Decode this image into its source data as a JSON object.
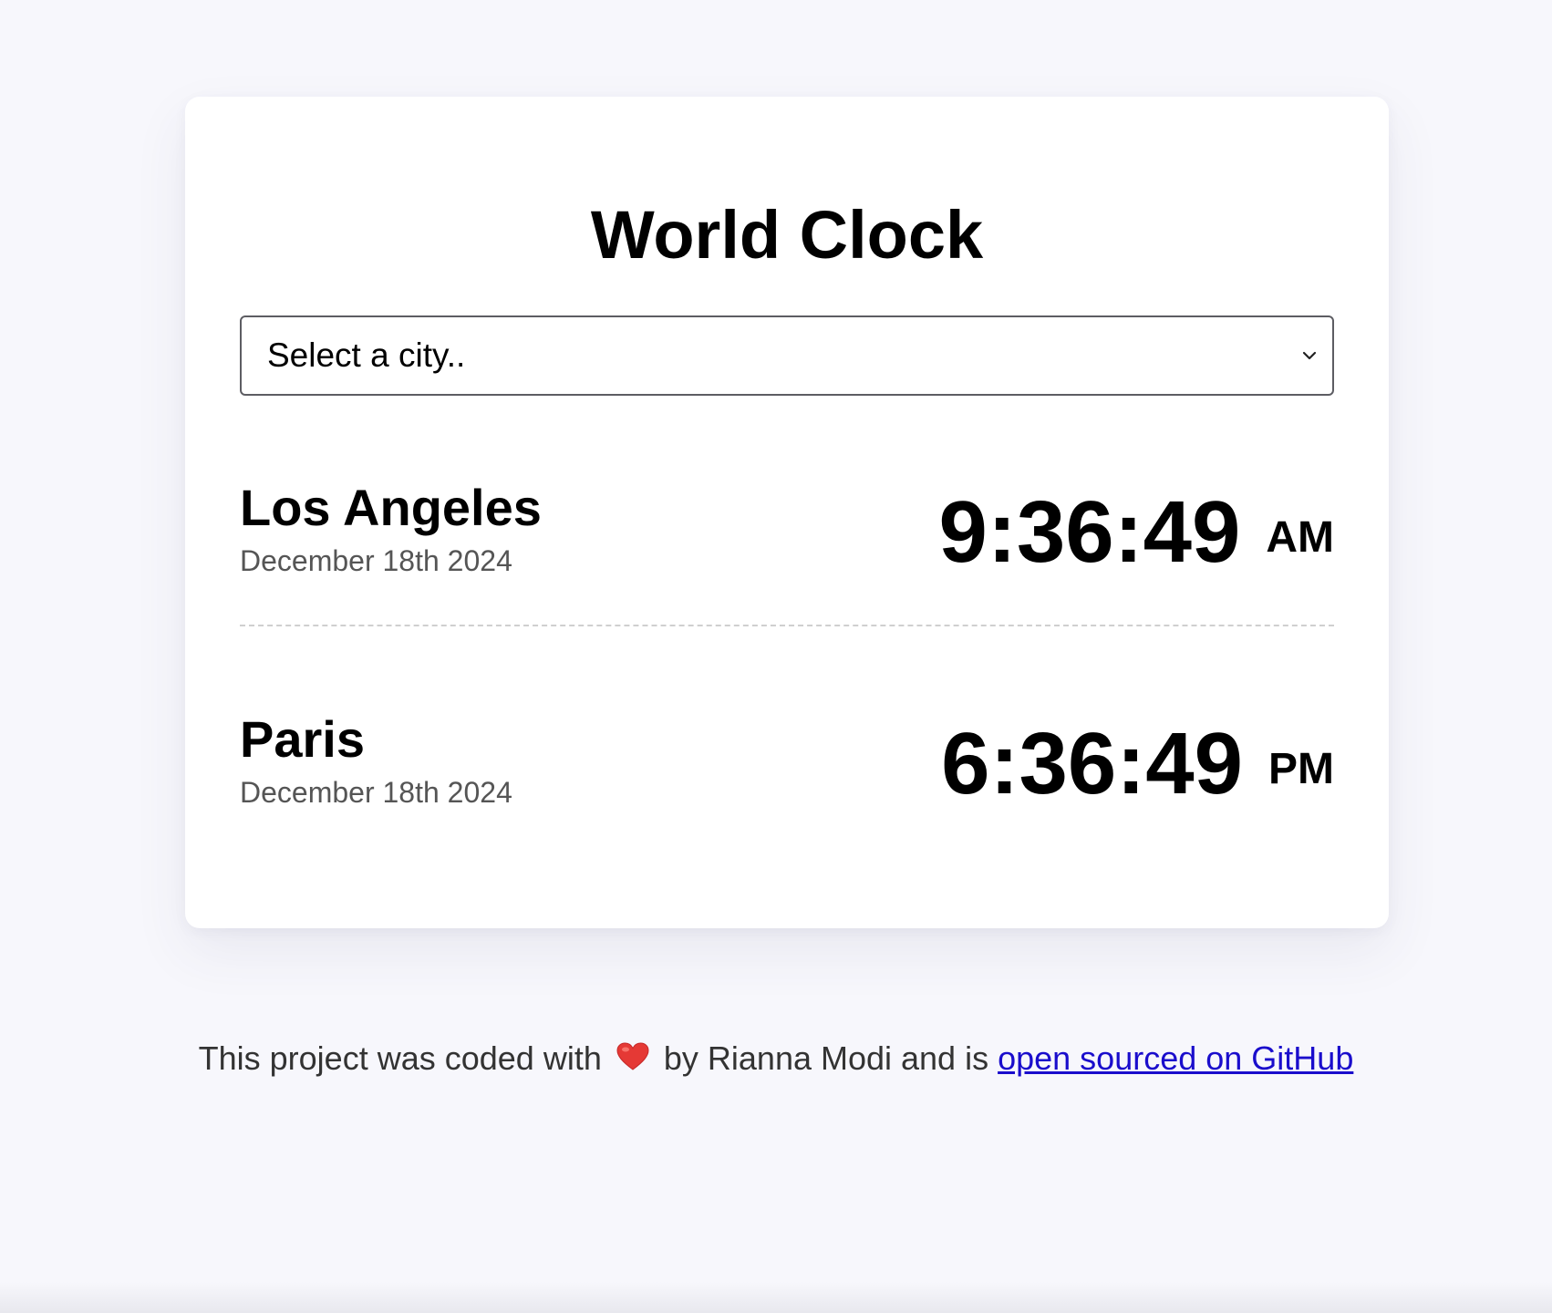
{
  "app": {
    "title": "World Clock"
  },
  "city_select": {
    "selected_label": "Select a city..",
    "icon": "chevron-down-icon"
  },
  "cities": [
    {
      "name": "Los Angeles",
      "date": "December 18th 2024",
      "time": "9:36:49",
      "period": "AM"
    },
    {
      "name": "Paris",
      "date": "December 18th 2024",
      "time": "6:36:49",
      "period": "PM"
    }
  ],
  "footer": {
    "text_before": "This project was coded with",
    "heart_icon": "heart-icon",
    "heart_color": "#e53935",
    "text_after": "by Rianna Modi and is",
    "link_text": "open sourced on GitHub",
    "link_color": "#1a0dcc"
  },
  "colors": {
    "background": "#f7f7fc",
    "card": "#ffffff",
    "date_text": "#555555"
  }
}
